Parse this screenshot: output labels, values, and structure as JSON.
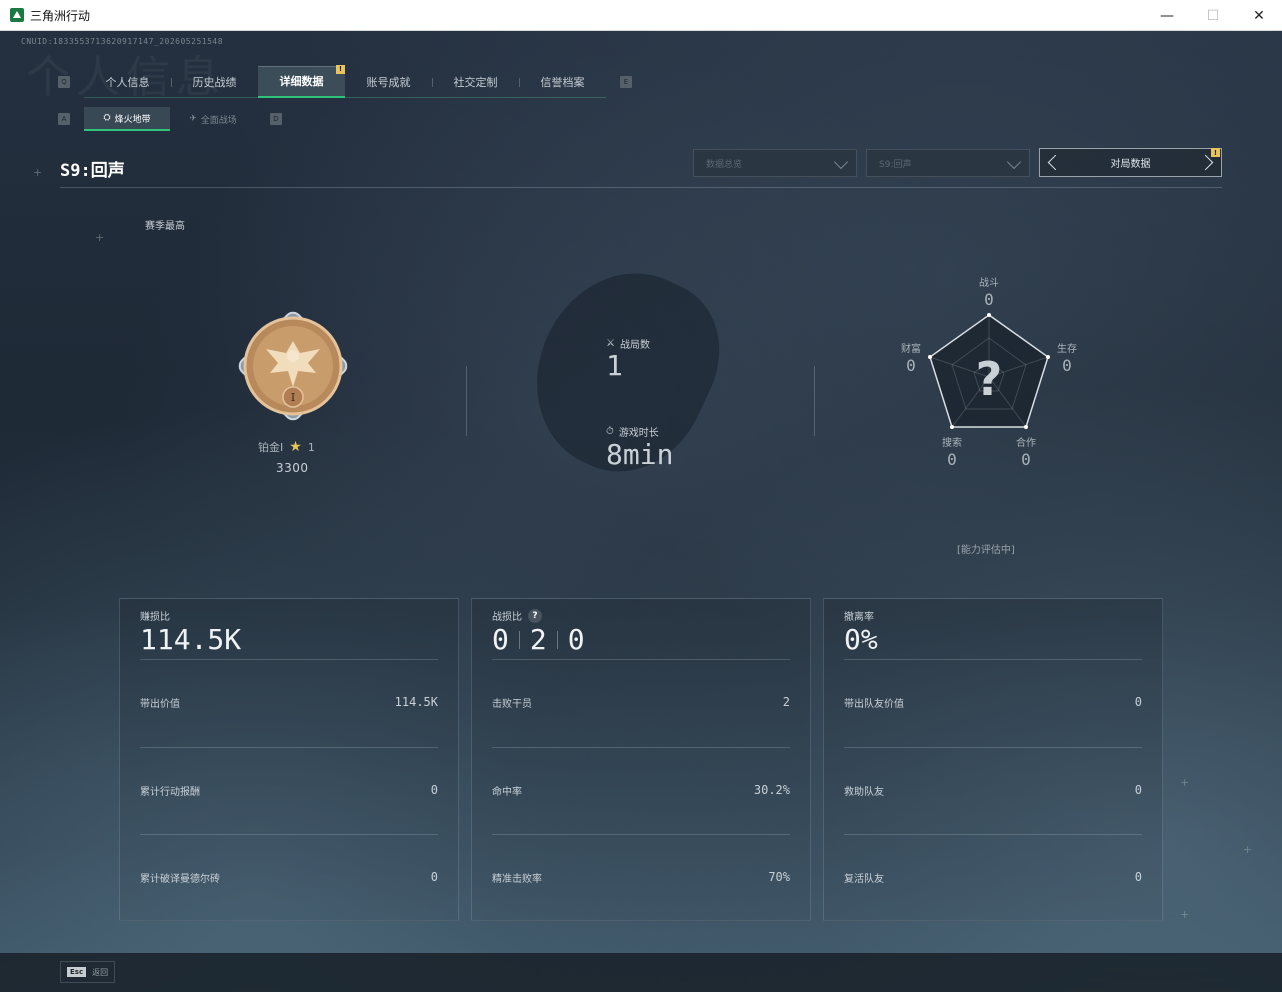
{
  "window": {
    "title": "三角洲行动",
    "controls": {
      "minimize": "—",
      "maximize": "☐",
      "close": "✕"
    }
  },
  "uid": "CNUID:1833553713620917147_202605251548",
  "nav": {
    "prev_key": "Q",
    "next_key": "E",
    "tabs": [
      {
        "label": "个人信息"
      },
      {
        "label": "历史战绩"
      },
      {
        "label": "详细数据",
        "active": true,
        "badge": "!"
      },
      {
        "label": "账号成就"
      },
      {
        "label": "社交定制"
      },
      {
        "label": "信誉档案"
      }
    ]
  },
  "subnav": {
    "prev_key": "A",
    "next_key": "D",
    "tabs": [
      {
        "label": "烽火地带",
        "active": true
      },
      {
        "label": "全面战场"
      }
    ]
  },
  "season": {
    "title": "S9:回声",
    "filter_data": "数据总览",
    "filter_season": "S9:回声",
    "pager_label": "对局数据",
    "pager_badge": "!"
  },
  "rank": {
    "section_label": "赛季最高",
    "tier": "铂金I",
    "stars": "1",
    "score": "3300",
    "medal_numeral": "I"
  },
  "summary": {
    "matches_label": "战局数",
    "matches_value": "1",
    "playtime_label": "游戏时长",
    "playtime_value": "8min"
  },
  "radar": {
    "center_symbol": "?",
    "status": "[能力评估中]",
    "axes": [
      {
        "label": "战斗",
        "value": "0"
      },
      {
        "label": "生存",
        "value": "0"
      },
      {
        "label": "合作",
        "value": "0"
      },
      {
        "label": "搜索",
        "value": "0"
      },
      {
        "label": "财富",
        "value": "0"
      }
    ]
  },
  "cards": {
    "profit": {
      "title": "赚损比",
      "big": "114.5K",
      "rows": [
        {
          "label": "带出价值",
          "value": "114.5K"
        },
        {
          "label": "累计行动报酬",
          "value": "0"
        },
        {
          "label": "累计破译曼德尔砖",
          "value": "0"
        }
      ]
    },
    "combat": {
      "title": "战损比",
      "help": "?",
      "kd": [
        "0",
        "2",
        "0"
      ],
      "rows": [
        {
          "label": "击败干员",
          "value": "2"
        },
        {
          "label": "命中率",
          "value": "30.2%"
        },
        {
          "label": "精准击败率",
          "value": "70%"
        }
      ]
    },
    "extract": {
      "title": "撤离率",
      "big": "0%",
      "rows": [
        {
          "label": "带出队友价值",
          "value": "0"
        },
        {
          "label": "救助队友",
          "value": "0"
        },
        {
          "label": "复活队友",
          "value": "0"
        }
      ]
    }
  },
  "footer": {
    "esc_key": "Esc",
    "esc_label": "返回"
  },
  "colors": {
    "accent": "#31c27a",
    "badge": "#e8c45a",
    "gold": "#e5c45c"
  }
}
